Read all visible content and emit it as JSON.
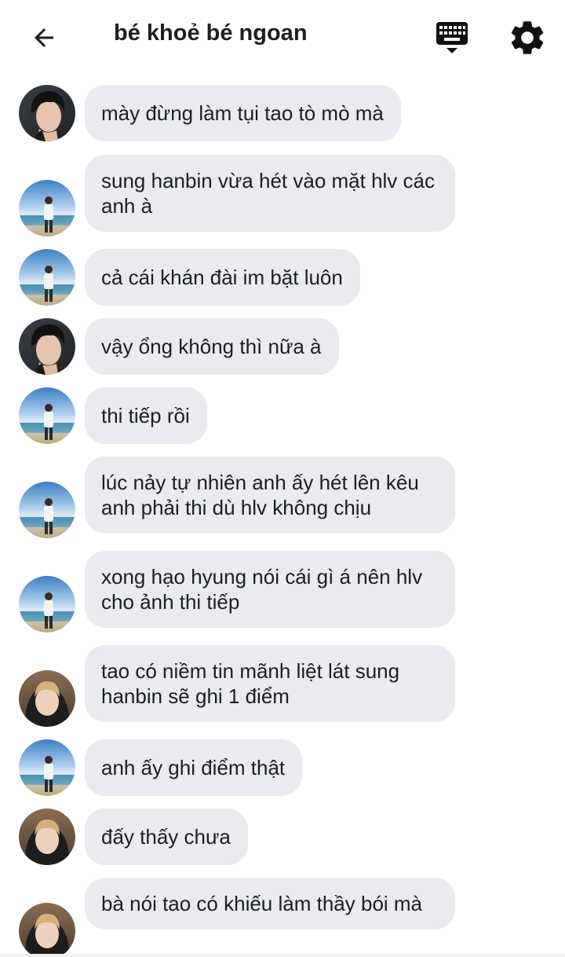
{
  "header": {
    "title": "bé khoẻ bé ngoan",
    "icons": {
      "back": "arrow-left-icon",
      "keyboard": "keyboard-icon",
      "settings": "gear-icon"
    }
  },
  "colors": {
    "bubble_bg": "#e9ebee",
    "text": "#1c1e21"
  },
  "messages": [
    {
      "sender_avatar": "dark-hair-boy-avatar",
      "text": "mày đừng làm tụi tao tò mò mà"
    },
    {
      "sender_avatar": "beach-boy-avatar",
      "text": "sung hanbin vừa hét vào mặt hlv các anh à"
    },
    {
      "sender_avatar": "beach-boy-avatar",
      "text": "cả cái khán đài im bặt luôn"
    },
    {
      "sender_avatar": "dark-hair-boy-avatar",
      "text": "vậy ổng không thì nữa à"
    },
    {
      "sender_avatar": "beach-boy-avatar",
      "text": "thi tiếp rồi"
    },
    {
      "sender_avatar": "beach-boy-avatar",
      "text": "lúc nảy tự nhiên anh ấy hét lên kêu anh phải thi dù hlv không chịu"
    },
    {
      "sender_avatar": "beach-boy-avatar",
      "text": "xong hạo hyung nói cái gì á nên hlv cho ảnh thi tiếp"
    },
    {
      "sender_avatar": "blonde-boy-avatar",
      "text": "tao có niềm tin mãnh liệt lát sung hanbin sẽ ghi 1 điểm"
    },
    {
      "sender_avatar": "beach-boy-avatar",
      "text": "anh ấy ghi điểm thật"
    },
    {
      "sender_avatar": "blonde-boy-avatar",
      "text": "đấy thấy chưa"
    },
    {
      "sender_avatar": "blonde-boy-avatar",
      "text": "bà nói tao có khiếu làm thầy bói mà"
    }
  ]
}
